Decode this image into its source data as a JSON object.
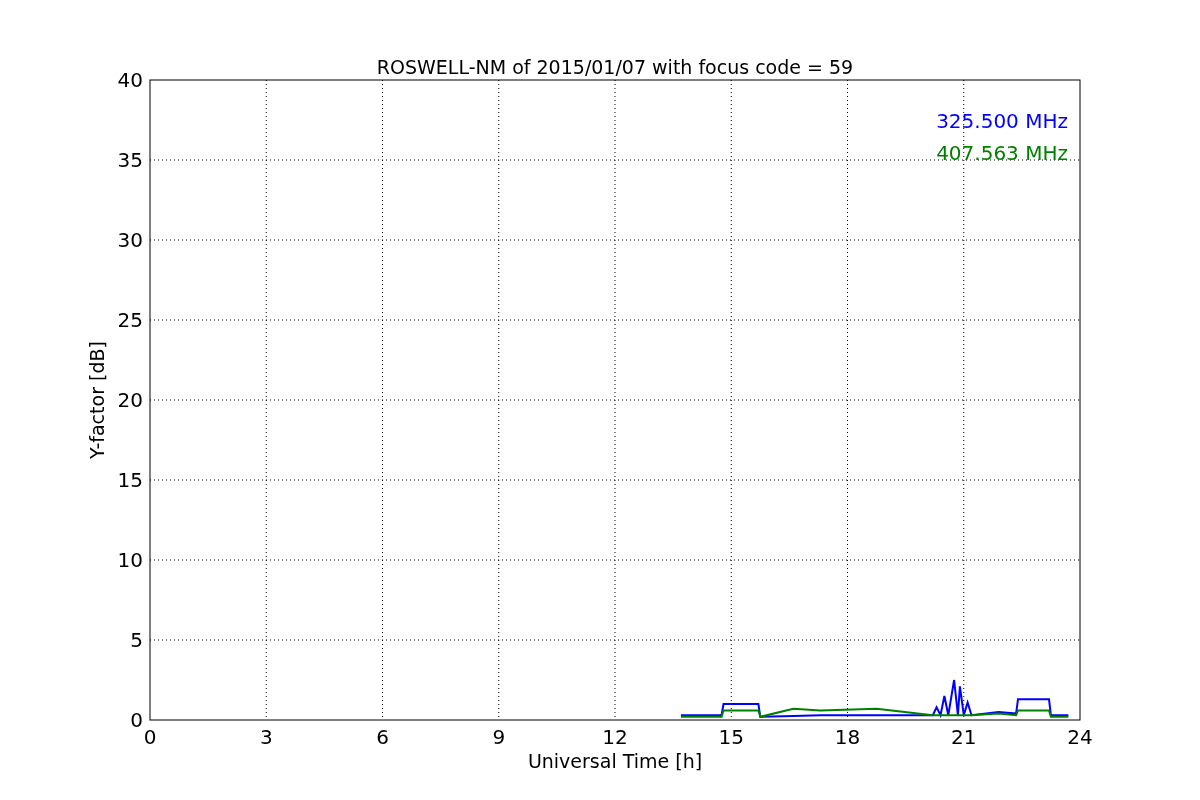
{
  "chart_data": {
    "type": "line",
    "title": "ROSWELL-NM of 2015/01/07 with focus code = 59",
    "xlabel": "Universal Time [h]",
    "ylabel": "Y-factor [dB]",
    "x": [
      13.7,
      14.75,
      14.8,
      15.7,
      15.75,
      16.6,
      17.3,
      18.75,
      20.2,
      20.3,
      20.4,
      20.5,
      20.6,
      20.75,
      20.85,
      20.9,
      21.0,
      21.1,
      21.2,
      21.9,
      22.35,
      22.4,
      23.2,
      23.25,
      23.7
    ],
    "series": [
      {
        "name": "325.500 MHz",
        "color": "#0000ff",
        "values": [
          0.3,
          0.3,
          1.0,
          1.0,
          0.2,
          0.25,
          0.3,
          0.3,
          0.3,
          0.8,
          0.3,
          1.5,
          0.3,
          2.5,
          0.3,
          2.1,
          0.3,
          1.1,
          0.3,
          0.5,
          0.4,
          1.3,
          1.3,
          0.3,
          0.3
        ]
      },
      {
        "name": "407.563 MHz",
        "color": "#008000",
        "values": [
          0.2,
          0.2,
          0.6,
          0.6,
          0.2,
          0.7,
          0.6,
          0.7,
          0.3,
          0.3,
          0.3,
          0.3,
          0.3,
          0.3,
          0.3,
          0.3,
          0.3,
          0.3,
          0.3,
          0.4,
          0.3,
          0.6,
          0.6,
          0.2,
          0.2
        ]
      }
    ],
    "xlim": [
      0,
      24
    ],
    "ylim": [
      0,
      40
    ],
    "xticks": [
      0,
      3,
      6,
      9,
      12,
      15,
      18,
      21,
      24
    ],
    "yticks": [
      0,
      5,
      10,
      15,
      20,
      25,
      30,
      35,
      40
    ],
    "grid": true
  }
}
